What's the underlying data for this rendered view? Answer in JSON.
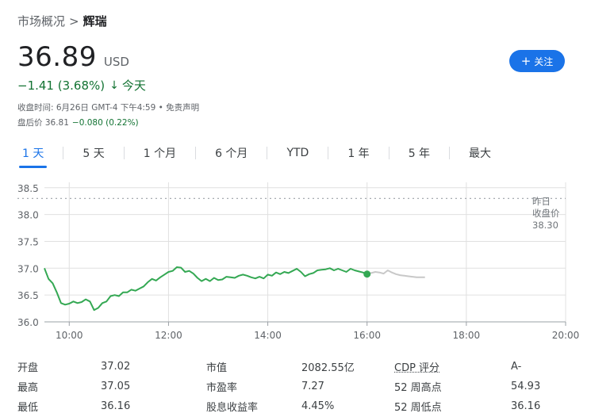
{
  "breadcrumb": {
    "parent": "市场概况",
    "separator": ">",
    "current": "辉瑞"
  },
  "quote": {
    "price": "36.89",
    "currency": "USD",
    "change": "−1.41 (3.68%)",
    "change_arrow": "↓",
    "period": "今天",
    "close_time": "收盘时间: 6月26日 GMT-4 下午4:59 • 免责声明",
    "after_hours_label": "盘后价 36.81",
    "after_hours_change": "−0.080 (0.22%)"
  },
  "follow_button": {
    "icon": "plus-icon",
    "label": "关注"
  },
  "tabs": [
    {
      "label": "1 天",
      "active": true
    },
    {
      "label": "5 天",
      "active": false
    },
    {
      "label": "1 个月",
      "active": false
    },
    {
      "label": "6 个月",
      "active": false
    },
    {
      "label": "YTD",
      "active": false
    },
    {
      "label": "1 年",
      "active": false
    },
    {
      "label": "5 年",
      "active": false
    },
    {
      "label": "最大",
      "active": false
    }
  ],
  "colors": {
    "accent": "#1a73e8",
    "down": "#137333",
    "line": "#34a853",
    "after_hours_line": "#c8c8c8",
    "grid": "#e0e0e0"
  },
  "chart_data": {
    "type": "line",
    "x_ticks": [
      "10:00",
      "12:00",
      "14:00",
      "16:00",
      "18:00",
      "20:00"
    ],
    "y_ticks": [
      "38.5",
      "38.0",
      "37.5",
      "37.0",
      "36.5",
      "36.0"
    ],
    "ylim": [
      36.0,
      38.6
    ],
    "xlim": [
      "09:30",
      "20:00"
    ],
    "grid": true,
    "reference_line": {
      "label_lines": [
        "昨日",
        "收盘价",
        "38.30"
      ],
      "value": 38.3
    },
    "series": [
      {
        "x": [
          "09:30",
          "09:35",
          "09:40",
          "09:45",
          "09:50",
          "09:55",
          "10:00",
          "10:05",
          "10:10",
          "10:15",
          "10:20",
          "10:25",
          "10:30",
          "10:35",
          "10:40",
          "10:45",
          "10:50",
          "10:55",
          "11:00",
          "11:05",
          "11:10",
          "11:15",
          "11:20",
          "11:25",
          "11:30",
          "11:35",
          "11:40",
          "11:45",
          "11:50",
          "11:55",
          "12:00",
          "12:05",
          "12:10",
          "12:15",
          "12:20",
          "12:25",
          "12:30",
          "12:35",
          "12:40",
          "12:45",
          "12:50",
          "12:55",
          "13:00",
          "13:05",
          "13:10",
          "13:15",
          "13:20",
          "13:25",
          "13:30",
          "13:35",
          "13:40",
          "13:45",
          "13:50",
          "13:55",
          "14:00",
          "14:05",
          "14:10",
          "14:15",
          "14:20",
          "14:25",
          "14:30",
          "14:35",
          "14:40",
          "14:45",
          "14:50",
          "14:55",
          "15:00",
          "15:05",
          "15:10",
          "15:15",
          "15:20",
          "15:25",
          "15:30",
          "15:35",
          "15:40",
          "15:45",
          "15:50",
          "15:55",
          "16:00"
        ],
        "values": [
          37.0,
          36.8,
          36.72,
          36.55,
          36.35,
          36.32,
          36.34,
          36.38,
          36.35,
          36.37,
          36.42,
          36.38,
          36.22,
          36.26,
          36.35,
          36.38,
          36.48,
          36.5,
          36.48,
          36.55,
          36.55,
          36.6,
          36.58,
          36.62,
          36.66,
          36.74,
          36.8,
          36.77,
          36.83,
          36.88,
          36.93,
          36.95,
          37.02,
          37.01,
          36.93,
          36.95,
          36.9,
          36.82,
          36.76,
          36.8,
          36.76,
          36.82,
          36.78,
          36.79,
          36.84,
          36.83,
          36.82,
          36.86,
          36.88,
          36.86,
          36.83,
          36.81,
          36.84,
          36.81,
          36.88,
          36.86,
          36.92,
          36.89,
          36.93,
          36.91,
          36.95,
          36.99,
          36.93,
          36.85,
          36.89,
          36.91,
          36.96,
          36.97,
          36.98,
          37.0,
          36.96,
          36.99,
          36.96,
          36.93,
          36.99,
          36.96,
          36.94,
          36.92,
          36.89
        ]
      },
      {
        "x": [
          "16:00",
          "16:05",
          "16:10",
          "16:15",
          "16:20",
          "16:25",
          "16:30",
          "16:35",
          "16:40",
          "16:45",
          "16:50",
          "16:55",
          "17:00",
          "17:05",
          "17:10"
        ],
        "values": [
          36.89,
          36.91,
          36.93,
          36.92,
          36.9,
          36.96,
          36.92,
          36.89,
          36.87,
          36.86,
          36.85,
          36.84,
          36.83,
          36.83,
          36.83
        ]
      }
    ]
  },
  "stats": [
    [
      {
        "label": "开盘",
        "value": "37.02"
      },
      {
        "label": "市值",
        "value": "2082.55亿"
      },
      {
        "label": "CDP 评分",
        "value": "A-"
      }
    ],
    [
      {
        "label": "最高",
        "value": "37.05"
      },
      {
        "label": "市盈率",
        "value": "7.27"
      },
      {
        "label": "52 周高点",
        "value": "54.93"
      }
    ],
    [
      {
        "label": "最低",
        "value": "36.16"
      },
      {
        "label": "股息收益率",
        "value": "4.45%"
      },
      {
        "label": "52 周低点",
        "value": "36.16"
      }
    ]
  ]
}
